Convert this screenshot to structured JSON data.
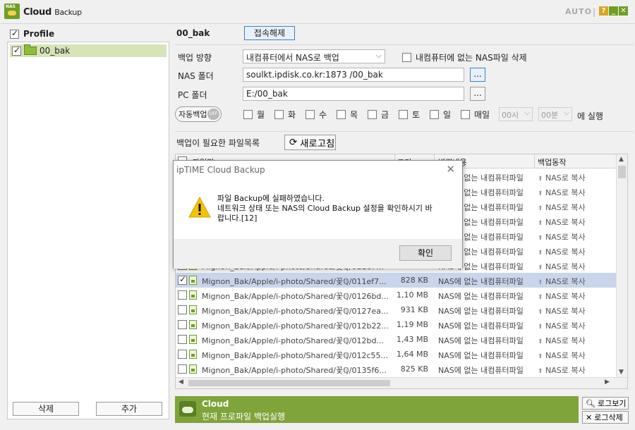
{
  "app": {
    "logo_text": "NAS",
    "title_main": "Cloud",
    "title_sub": "Backup",
    "auto_label": "AUTO",
    "sep": "|",
    "help_glyph": "?",
    "min_glyph": "_",
    "close_glyph": "✕"
  },
  "sidebar": {
    "header": "Profile",
    "profiles": [
      {
        "name": "00_bak",
        "checked": true
      }
    ],
    "delete_label": "삭제",
    "add_label": "추가"
  },
  "profile": {
    "name": "00_bak",
    "disconnect_label": "접속해제",
    "direction_label": "백업 방향",
    "direction_value": "내컴퓨터에서 NAS로 백업",
    "delete_option_label": "내컴퓨터에 없는 NAS파일 삭제",
    "nas_folder_label": "NAS 폴더",
    "nas_folder_value": "soulkt.ipdisk.co.kr:1873 /00_bak",
    "pc_folder_label": "PC 폴더",
    "pc_folder_value": "E:/00_bak",
    "browse_label": "...",
    "auto_backup_label": "자동백업",
    "toggle_state": "OFF",
    "days": [
      "월",
      "화",
      "수",
      "목",
      "금",
      "토",
      "일",
      "매일"
    ],
    "hour_value": "00시",
    "minute_value": "00분",
    "exec_label": "에 실행"
  },
  "files": {
    "label": "백업이 필요한 파일목록",
    "refresh_label": "새로고침",
    "columns": [
      "파일명",
      "크기",
      "변경내용",
      "백업동작"
    ],
    "rows": [
      {
        "name": "Mignon_Bak/Apple/i-photo/Shared/꽃ℚ/011c5...",
        "size": "",
        "change": "NAS에 없는 내컴퓨터파일",
        "action": "NAS로 복사",
        "checked": false
      },
      {
        "name": "Mignon_Bak/Apple/i-photo/Shared/꽃ℚ/011d2...",
        "size": "",
        "change": "NAS에 없는 내컴퓨터파일",
        "action": "NAS로 복사",
        "checked": false
      },
      {
        "name": "Mignon_Bak/Apple/i-photo/Shared/꽃ℚ/011d8...",
        "size": "",
        "change": "NAS에 없는 내컴퓨터파일",
        "action": "NAS로 복사",
        "checked": false
      },
      {
        "name": "Mignon_Bak/Apple/i-photo/Shared/꽃ℚ/011dc...",
        "size": "",
        "change": "NAS에 없는 내컴퓨터파일",
        "action": "NAS로 복사",
        "checked": false
      },
      {
        "name": "Mignon_Bak/Apple/i-photo/Shared/꽃ℚ/011e2...",
        "size": "",
        "change": "NAS에 없는 내컴퓨터파일",
        "action": "NAS로 복사",
        "checked": false
      },
      {
        "name": "Mignon_Bak/Apple/i-photo/Shared/꽃ℚ/011e5...",
        "size": "",
        "change": "NAS에 없는 내컴퓨터파일",
        "action": "NAS로 복사",
        "checked": false
      },
      {
        "name": "Mignon_Bak/Apple/i-photo/Shared/꽃ℚ/011e7...",
        "size": "",
        "change": "NAS에 없는 내컴퓨터파일",
        "action": "NAS로 복사",
        "checked": false
      },
      {
        "name": "Mignon_Bak/Apple/i-photo/Shared/꽃ℚ/011ef7...",
        "size": "828 KB",
        "change": "NAS에 없는 내컴퓨터파일",
        "action": "NAS로 복사",
        "checked": true
      },
      {
        "name": "Mignon_Bak/Apple/i-photo/Shared/꽃ℚ/0126bd...",
        "size": "1,10 MB",
        "change": "NAS에 없는 내컴퓨터파일",
        "action": "NAS로 복사",
        "checked": false
      },
      {
        "name": "Mignon_Bak/Apple/i-photo/Shared/꽃ℚ/0127ea...",
        "size": "931 KB",
        "change": "NAS에 없는 내컴퓨터파일",
        "action": "NAS로 복사",
        "checked": false
      },
      {
        "name": "Mignon_Bak/Apple/i-photo/Shared/꽃ℚ/012b22...",
        "size": "1,19 MB",
        "change": "NAS에 없는 내컴퓨터파일",
        "action": "NAS로 복사",
        "checked": false
      },
      {
        "name": "Mignon_Bak/Apple/i-photo/Shared/꽃ℚ/012bd...",
        "size": "1,43 MB",
        "change": "NAS에 없는 내컴퓨터파일",
        "action": "NAS로 복사",
        "checked": false
      },
      {
        "name": "Mignon_Bak/Apple/i-photo/Shared/꽃ℚ/012c55...",
        "size": "1,64 MB",
        "change": "NAS에 없는 내컴퓨터파일",
        "action": "NAS로 복사",
        "checked": false
      },
      {
        "name": "Mignon_Bak/Apple/i-photo/Shared/꽃ℚ/0135f6...",
        "size": "825 KB",
        "change": "NAS에 없는 내컴퓨터파일",
        "action": "NAS로 복사",
        "checked": false
      }
    ]
  },
  "status": {
    "title": "Cloud",
    "message": "현재 프로파일 백업실행",
    "log_view_label": "로그보기",
    "log_delete_label": "로그삭제"
  },
  "dialog": {
    "title": "ipTIME Cloud Backup",
    "close_glyph": "✕",
    "line1": "파일 Backup에 실패하였습니다.",
    "line2": "네트워크 상태 또는 NAS의 Cloud Backup 설정을 확인하시기 바",
    "line3": "랍니다.[12]",
    "ok_label": "확인"
  },
  "colors": {
    "accent_green": "#7ea43a",
    "selected_row": "#cad5ec",
    "profile_highlight": "#d6e4b8"
  }
}
